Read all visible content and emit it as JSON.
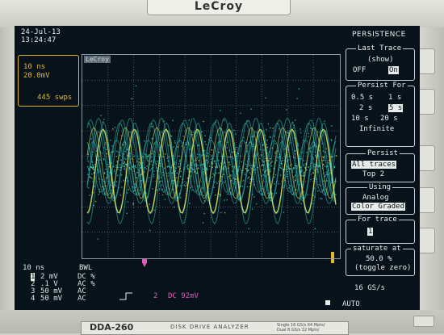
{
  "bezel": {
    "brand": "LeCroy",
    "model": "DDA-260",
    "subtitle": "DISK DRIVE ANALYZER",
    "spec_line1": "Single 16 GS/s 64 Mpts/",
    "spec_line2": "Dual 8 GS/s 32 Mpts/"
  },
  "status": {
    "date": "24-Jul-13",
    "time": "13:24:47"
  },
  "timebase": {
    "time_div": "10 ns",
    "volt_div": "20.0mV",
    "sweeps": "445 swps"
  },
  "grid": {
    "logo": "LeCroy"
  },
  "trace_panel": {
    "time_div": "10 ns",
    "bwl": "BWL",
    "channels": [
      {
        "num": "1",
        "scale": "2 mV",
        "coupling": "DC",
        "flag": "%"
      },
      {
        "num": "2",
        "scale": ".1 V",
        "coupling": "AC",
        "flag": "%"
      },
      {
        "num": "3",
        "scale": "50 mV",
        "coupling": "AC",
        "flag": ""
      },
      {
        "num": "4",
        "scale": "50 mV",
        "coupling": "AC",
        "flag": ""
      }
    ],
    "trigger_channel": "2",
    "trigger_coupling": "DC 92mV",
    "sample_rate": "16 GS/s",
    "trigger_mode": "AUTO"
  },
  "menu": {
    "title": "PERSISTENCE",
    "last_trace": {
      "header": "Last Trace",
      "sub": "(show)",
      "off": "OFF",
      "on": "On"
    },
    "persist_for": {
      "header": "Persist For",
      "options": [
        "0.5 s",
        "1 s",
        "2 s",
        "5 s",
        "10 s",
        "20 s",
        "Infinite"
      ],
      "selected": "5 s"
    },
    "persist": {
      "header": "Persist",
      "opt1": "All traces",
      "opt2": "Top 2",
      "selected": "All traces"
    },
    "using": {
      "header": "Using",
      "opt1": "Analog",
      "opt2": "Color Graded",
      "selected": "Color Graded"
    },
    "for_trace": {
      "header": "For trace",
      "value": "1"
    },
    "saturate": {
      "label": "saturate at",
      "value": "50.0 %",
      "hint": "(toggle zero)"
    }
  },
  "colors": {
    "screen_bg": "#07121a",
    "trace_cyan": "#37d7c8",
    "trace_yellow": "#d9df5a",
    "timebase_amber": "#e0b830",
    "marker_pink": "#e45ac0"
  }
}
